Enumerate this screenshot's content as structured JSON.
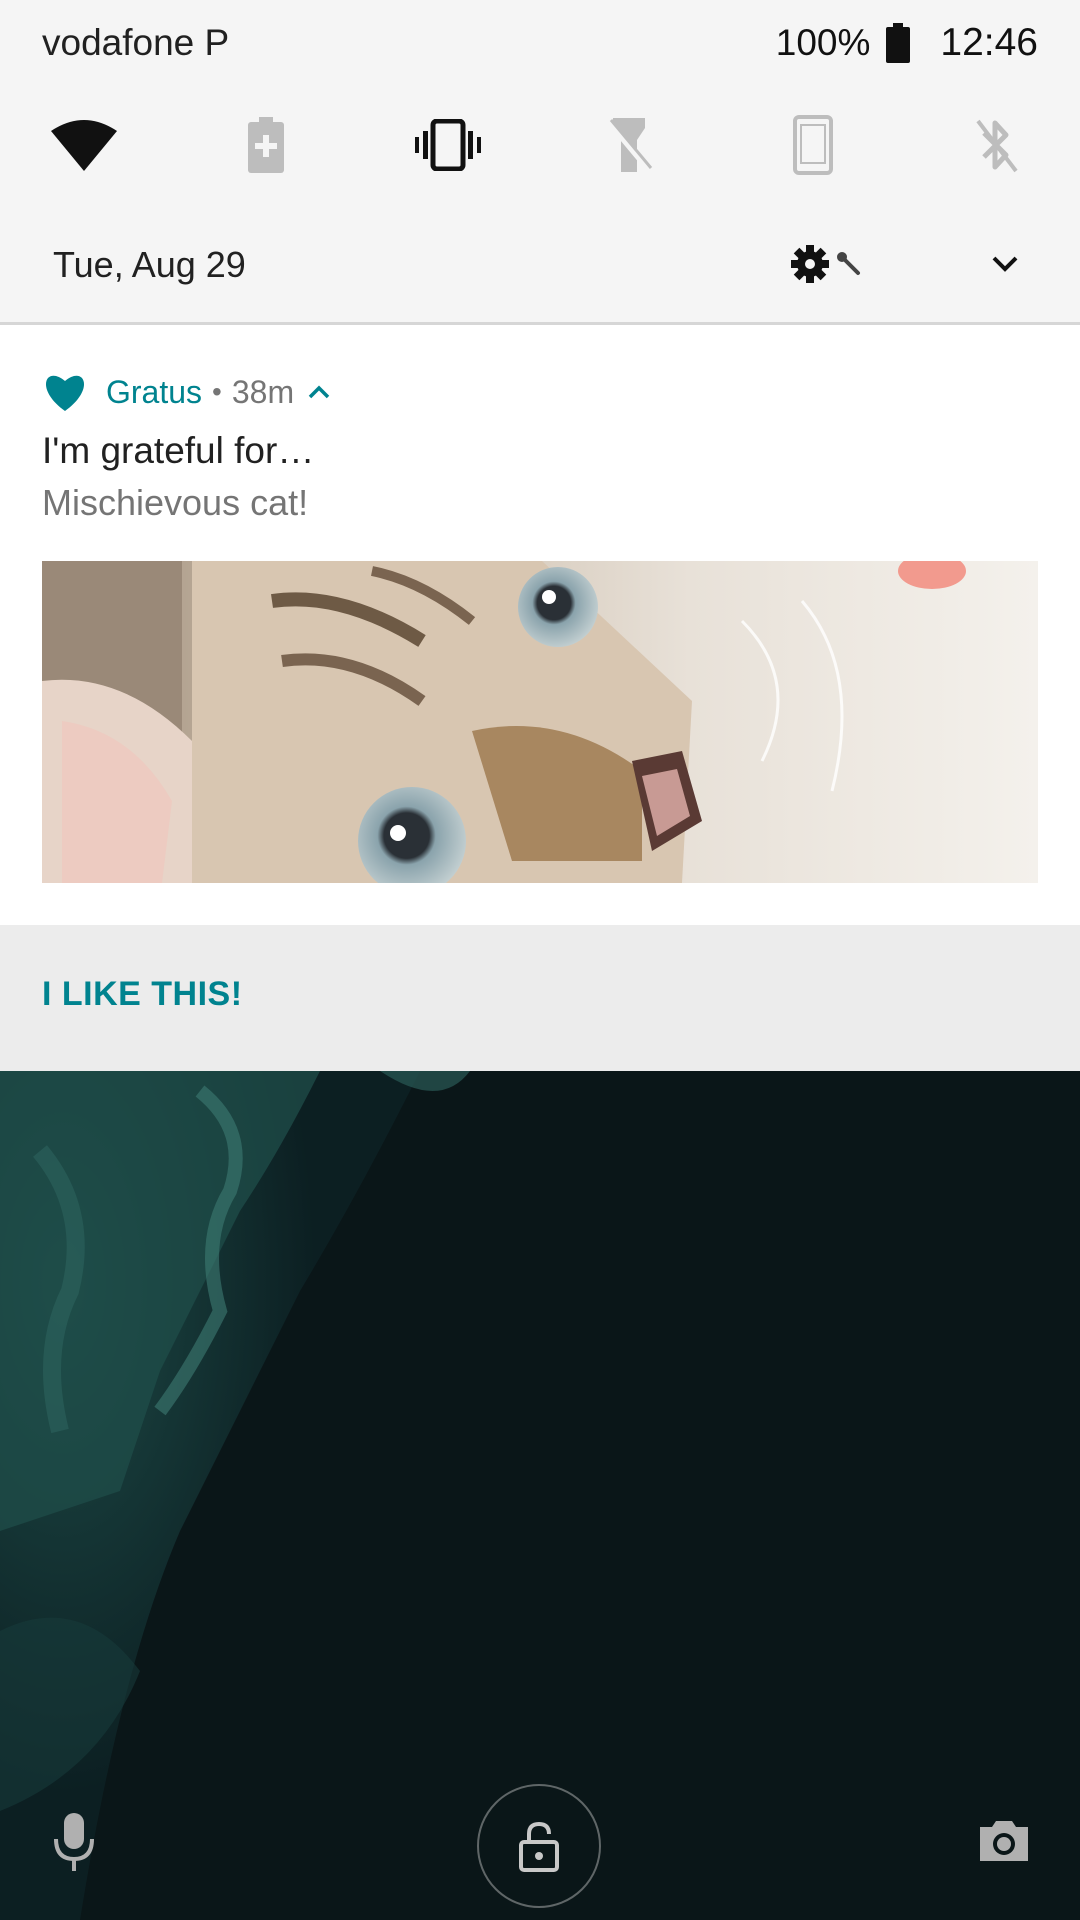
{
  "status_bar": {
    "carrier": "vodafone P",
    "battery_percent": "100%",
    "time": "12:46"
  },
  "quick_settings": {
    "tiles": [
      {
        "icon": "wifi-icon",
        "state": "on"
      },
      {
        "icon": "battery-saver-icon",
        "state": "off"
      },
      {
        "icon": "vibrate-icon",
        "state": "on"
      },
      {
        "icon": "flashlight-icon",
        "state": "off"
      },
      {
        "icon": "auto-rotate-icon",
        "state": "off"
      },
      {
        "icon": "bluetooth-icon",
        "state": "off"
      }
    ],
    "date": "Tue, Aug 29",
    "settings_icon": "gear-icon",
    "expand_icon": "chevron-down-icon"
  },
  "notification": {
    "app_name": "Gratus",
    "separator": "•",
    "time_ago": "38m",
    "title": "I'm grateful for…",
    "text": "Mischievous cat!",
    "image": "cat-photo",
    "action_label": "I LIKE THIS!"
  },
  "lock_screen": {
    "left_icon": "microphone-icon",
    "center_icon": "unlock-icon",
    "right_icon": "camera-icon"
  },
  "colors": {
    "accent": "#00838f",
    "panel_bg": "#f5f5f5",
    "action_bar_bg": "#ececec",
    "wallpaper": "#0b1a1c"
  }
}
